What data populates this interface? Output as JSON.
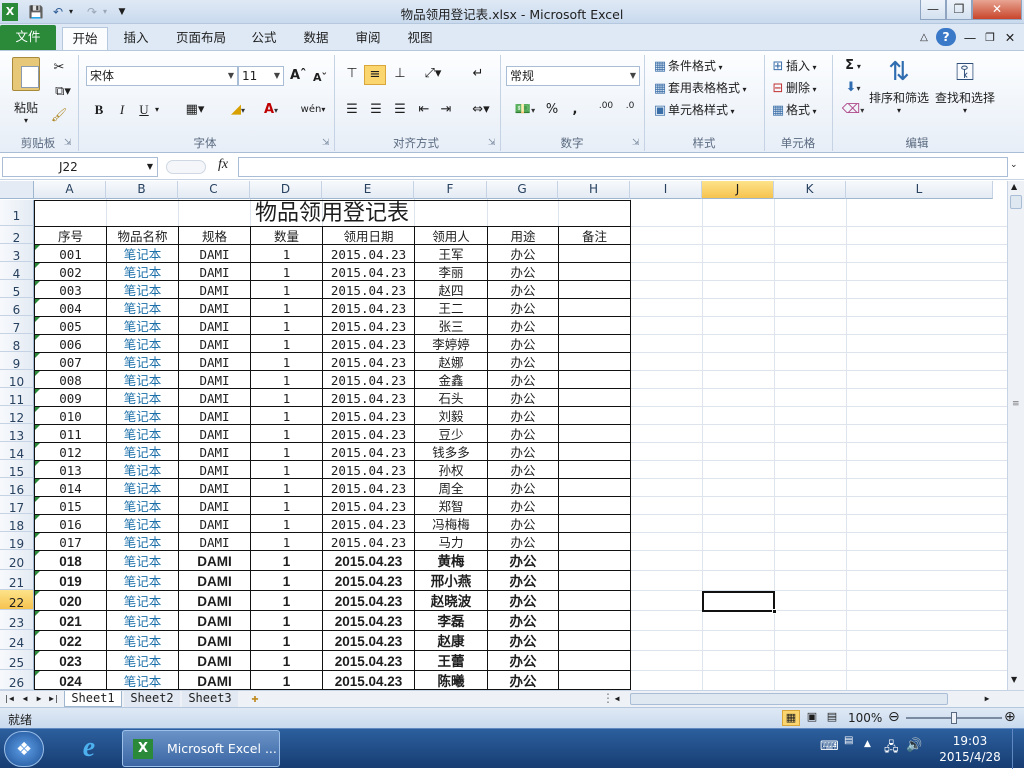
{
  "window": {
    "title": "物品领用登记表.xlsx - Microsoft Excel"
  },
  "ribbon": {
    "tabs": [
      "文件",
      "开始",
      "插入",
      "页面布局",
      "公式",
      "数据",
      "审阅",
      "视图"
    ],
    "active_tab": "开始",
    "clipboard": {
      "paste": "粘贴",
      "label": "剪贴板"
    },
    "font": {
      "name": "宋体",
      "size": "11",
      "label": "字体",
      "bold": "B",
      "italic": "I",
      "underline": "U",
      "phonetic": "wén"
    },
    "alignment": {
      "label": "对齐方式"
    },
    "number": {
      "format": "常规",
      "label": "数字",
      "percent": "%",
      "comma": ",",
      "inc_decimal": ".00",
      "dec_decimal": ".0"
    },
    "styles": {
      "conditional": "条件格式",
      "table": "套用表格格式",
      "cell": "单元格样式",
      "label": "样式"
    },
    "cells": {
      "insert": "插入",
      "delete": "删除",
      "format": "格式",
      "label": "单元格"
    },
    "editing": {
      "sum": "Σ",
      "sort": "排序和筛选",
      "find": "查找和选择",
      "label": "编辑"
    }
  },
  "formula_bar": {
    "name_box": "J22",
    "fx": "fx",
    "formula": ""
  },
  "sheet": {
    "columns": [
      "A",
      "B",
      "C",
      "D",
      "E",
      "F",
      "G",
      "H",
      "I",
      "J",
      "K",
      "L"
    ],
    "selected_column": "J",
    "selected_row": "22",
    "title": "物品领用登记表",
    "headers": [
      "序号",
      "物品名称",
      "规格",
      "数量",
      "领用日期",
      "领用人",
      "用途",
      "备注"
    ],
    "rows": [
      {
        "r": "3",
        "seq": "001",
        "item": "笔记本",
        "spec": "DAMI",
        "qty": "1",
        "date": "2015.04.23",
        "person": "王军",
        "use": "办公"
      },
      {
        "r": "4",
        "seq": "002",
        "item": "笔记本",
        "spec": "DAMI",
        "qty": "1",
        "date": "2015.04.23",
        "person": "李丽",
        "use": "办公"
      },
      {
        "r": "5",
        "seq": "003",
        "item": "笔记本",
        "spec": "DAMI",
        "qty": "1",
        "date": "2015.04.23",
        "person": "赵四",
        "use": "办公"
      },
      {
        "r": "6",
        "seq": "004",
        "item": "笔记本",
        "spec": "DAMI",
        "qty": "1",
        "date": "2015.04.23",
        "person": "王二",
        "use": "办公"
      },
      {
        "r": "7",
        "seq": "005",
        "item": "笔记本",
        "spec": "DAMI",
        "qty": "1",
        "date": "2015.04.23",
        "person": "张三",
        "use": "办公"
      },
      {
        "r": "8",
        "seq": "006",
        "item": "笔记本",
        "spec": "DAMI",
        "qty": "1",
        "date": "2015.04.23",
        "person": "李婷婷",
        "use": "办公"
      },
      {
        "r": "9",
        "seq": "007",
        "item": "笔记本",
        "spec": "DAMI",
        "qty": "1",
        "date": "2015.04.23",
        "person": "赵娜",
        "use": "办公"
      },
      {
        "r": "10",
        "seq": "008",
        "item": "笔记本",
        "spec": "DAMI",
        "qty": "1",
        "date": "2015.04.23",
        "person": "金鑫",
        "use": "办公"
      },
      {
        "r": "11",
        "seq": "009",
        "item": "笔记本",
        "spec": "DAMI",
        "qty": "1",
        "date": "2015.04.23",
        "person": "石头",
        "use": "办公"
      },
      {
        "r": "12",
        "seq": "010",
        "item": "笔记本",
        "spec": "DAMI",
        "qty": "1",
        "date": "2015.04.23",
        "person": "刘毅",
        "use": "办公"
      },
      {
        "r": "13",
        "seq": "011",
        "item": "笔记本",
        "spec": "DAMI",
        "qty": "1",
        "date": "2015.04.23",
        "person": "豆少",
        "use": "办公"
      },
      {
        "r": "14",
        "seq": "012",
        "item": "笔记本",
        "spec": "DAMI",
        "qty": "1",
        "date": "2015.04.23",
        "person": "钱多多",
        "use": "办公"
      },
      {
        "r": "15",
        "seq": "013",
        "item": "笔记本",
        "spec": "DAMI",
        "qty": "1",
        "date": "2015.04.23",
        "person": "孙权",
        "use": "办公"
      },
      {
        "r": "16",
        "seq": "014",
        "item": "笔记本",
        "spec": "DAMI",
        "qty": "1",
        "date": "2015.04.23",
        "person": "周全",
        "use": "办公"
      },
      {
        "r": "17",
        "seq": "015",
        "item": "笔记本",
        "spec": "DAMI",
        "qty": "1",
        "date": "2015.04.23",
        "person": "郑智",
        "use": "办公"
      },
      {
        "r": "18",
        "seq": "016",
        "item": "笔记本",
        "spec": "DAMI",
        "qty": "1",
        "date": "2015.04.23",
        "person": "冯梅梅",
        "use": "办公"
      },
      {
        "r": "19",
        "seq": "017",
        "item": "笔记本",
        "spec": "DAMI",
        "qty": "1",
        "date": "2015.04.23",
        "person": "马力",
        "use": "办公"
      },
      {
        "r": "20",
        "seq": "018",
        "item": "笔记本",
        "spec": "DAMI",
        "qty": "1",
        "date": "2015.04.23",
        "person": "黄梅",
        "use": "办公"
      },
      {
        "r": "21",
        "seq": "019",
        "item": "笔记本",
        "spec": "DAMI",
        "qty": "1",
        "date": "2015.04.23",
        "person": "邢小燕",
        "use": "办公"
      },
      {
        "r": "22",
        "seq": "020",
        "item": "笔记本",
        "spec": "DAMI",
        "qty": "1",
        "date": "2015.04.23",
        "person": "赵晓波",
        "use": "办公"
      },
      {
        "r": "23",
        "seq": "021",
        "item": "笔记本",
        "spec": "DAMI",
        "qty": "1",
        "date": "2015.04.23",
        "person": "李磊",
        "use": "办公"
      },
      {
        "r": "24",
        "seq": "022",
        "item": "笔记本",
        "spec": "DAMI",
        "qty": "1",
        "date": "2015.04.23",
        "person": "赵康",
        "use": "办公"
      },
      {
        "r": "25",
        "seq": "023",
        "item": "笔记本",
        "spec": "DAMI",
        "qty": "1",
        "date": "2015.04.23",
        "person": "王蕾",
        "use": "办公"
      },
      {
        "r": "26",
        "seq": "024",
        "item": "笔记本",
        "spec": "DAMI",
        "qty": "1",
        "date": "2015.04.23",
        "person": "陈曦",
        "use": "办公"
      }
    ]
  },
  "sheet_tabs": [
    "Sheet1",
    "Sheet2",
    "Sheet3"
  ],
  "active_sheet": "Sheet1",
  "status": {
    "ready": "就绪",
    "zoom": "100%"
  },
  "taskbar": {
    "app": "Microsoft Excel ...",
    "time": "19:03",
    "date": "2015/4/28"
  },
  "colors": {
    "accent_green": "#2a8a3a",
    "link_blue": "#1b6fa8",
    "selected_header": "#f6c34f"
  }
}
